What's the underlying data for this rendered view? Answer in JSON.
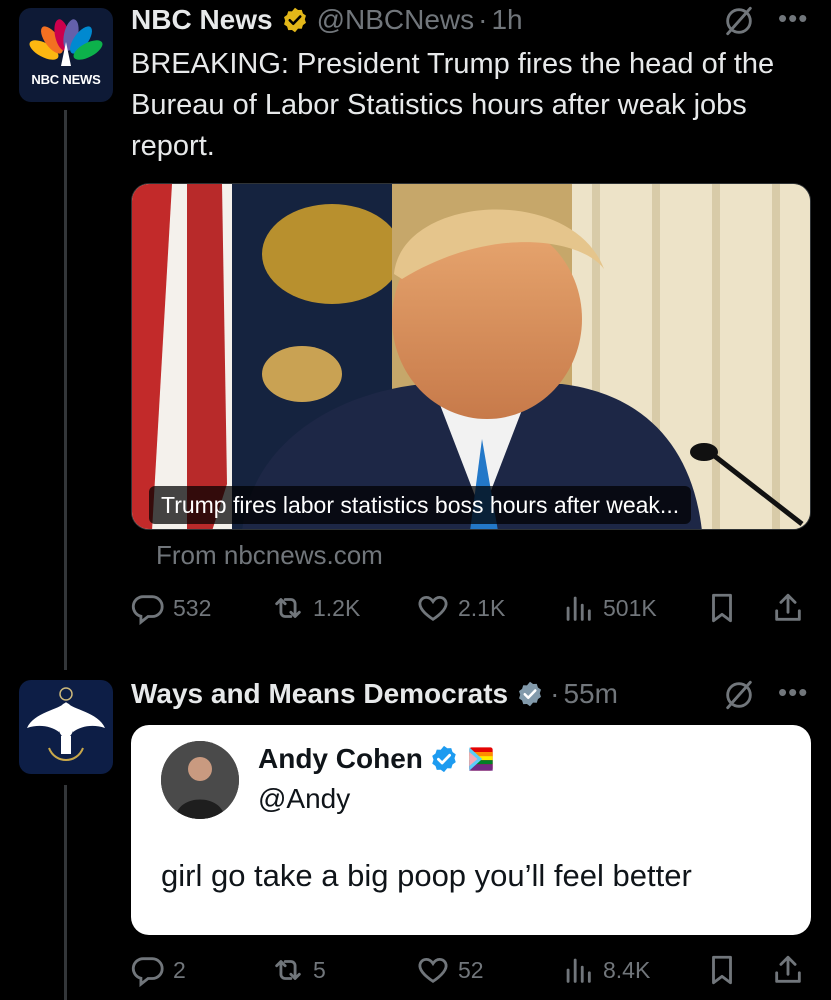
{
  "tweet1": {
    "avatar_label": "NBC NEWS",
    "name": "NBC News",
    "handle": "@NBCNews",
    "time": "1h",
    "text": "BREAKING: President Trump fires the head of the Bureau of Labor Statistics hours after weak jobs report.",
    "card_caption": "Trump fires labor statistics boss hours after weak...",
    "card_source": "From nbcnews.com",
    "replies": "532",
    "reposts": "1.2K",
    "likes": "2.1K",
    "views": "501K"
  },
  "tweet2": {
    "name": "Ways and Means Democrats",
    "time": "55m",
    "quote": {
      "name": "Andy Cohen",
      "handle": "@Andy",
      "text": "girl go take a big poop you’ll feel better"
    },
    "replies": "2",
    "reposts": "5",
    "likes": "52",
    "views": "8.4K"
  },
  "colors": {
    "background": "#000000",
    "text": "#e7e9ea",
    "muted": "#71767b",
    "verified_gold": "#e2b719",
    "verified_blue": "#1d9bf0",
    "thread_line": "#333639"
  },
  "icons": [
    "verified-badge-icon",
    "grok-icon",
    "more-icon",
    "reply-icon",
    "repost-icon",
    "like-icon",
    "views-icon",
    "bookmark-icon",
    "share-icon"
  ]
}
